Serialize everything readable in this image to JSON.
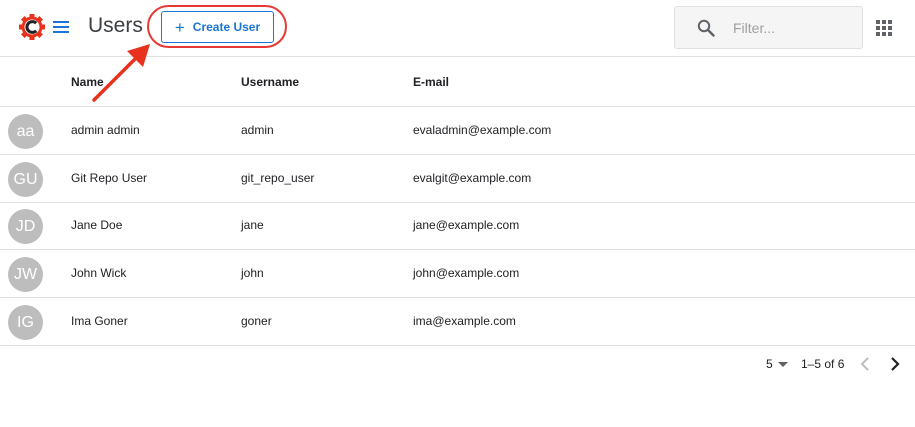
{
  "header": {
    "logo_icon": "cog-c-logo-icon",
    "menu_icon": "hamburger-menu-icon",
    "title": "Users",
    "create_button": {
      "icon": "plus-icon",
      "label": "Create User",
      "symbol": "+"
    },
    "filter": {
      "icon": "search-icon",
      "placeholder": "Filter...",
      "value": ""
    },
    "apps_icon": "apps-grid-icon"
  },
  "table": {
    "columns": [
      "Name",
      "Username",
      "E-mail"
    ],
    "rows": [
      {
        "initials": "aa",
        "name": "admin admin",
        "username": "admin",
        "email": "evaladmin@example.com"
      },
      {
        "initials": "GU",
        "name": "Git Repo User",
        "username": "git_repo_user",
        "email": "evalgit@example.com"
      },
      {
        "initials": "JD",
        "name": "Jane Doe",
        "username": "jane",
        "email": "jane@example.com"
      },
      {
        "initials": "JW",
        "name": "John Wick",
        "username": "john",
        "email": "john@example.com"
      },
      {
        "initials": "IG",
        "name": "Ima Goner",
        "username": "goner",
        "email": "ima@example.com"
      }
    ]
  },
  "pagination": {
    "per_page": "5",
    "range": "1–5 of 6",
    "prev_icon": "chevron-left-icon",
    "next_icon": "chevron-right-icon"
  },
  "annotation": {
    "ring_color": "#e53935",
    "arrow_color": "#e8321e"
  },
  "colors": {
    "accent": "#1976d2",
    "logo": "#e8321e",
    "avatar": "#bdbdbd"
  }
}
